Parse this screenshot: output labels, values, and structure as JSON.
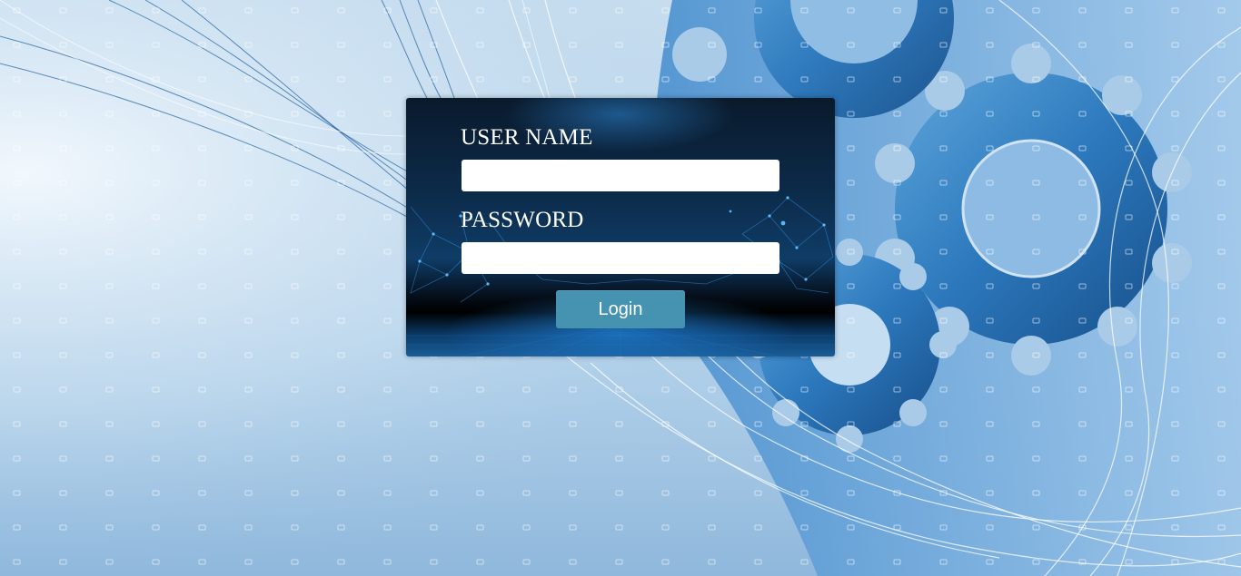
{
  "login": {
    "username_label": "USER NAME",
    "username_value": "",
    "password_label": "PASSWORD",
    "password_value": "",
    "login_button": "Login"
  },
  "theme": {
    "panel_dark": "#0a1a2c",
    "panel_accent": "#1a5d98",
    "button_color": "#4593b1",
    "background_light": "#cfe2f1",
    "background_mid": "#3b7fbf"
  },
  "background_art": [
    "gear-icon",
    "gear-icon",
    "gear-icon",
    "wave-lines",
    "dot-grid"
  ]
}
